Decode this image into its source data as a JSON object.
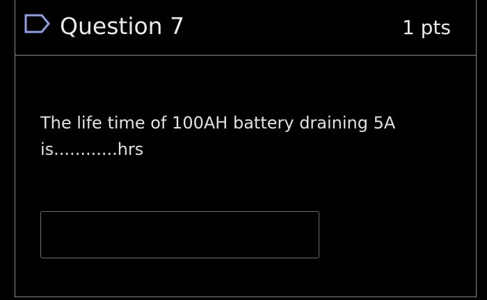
{
  "question": {
    "title": "Question 7",
    "points": "1 pts",
    "flag_icon": "flag-outline-icon",
    "text": "The life time of 100AH battery draining 5A is............hrs"
  },
  "answer": {
    "value": "",
    "placeholder": ""
  },
  "colors": {
    "background": "#000000",
    "border": "#8a8a8a",
    "text": "#e6e6e6",
    "input_border": "#6e6e6e"
  }
}
